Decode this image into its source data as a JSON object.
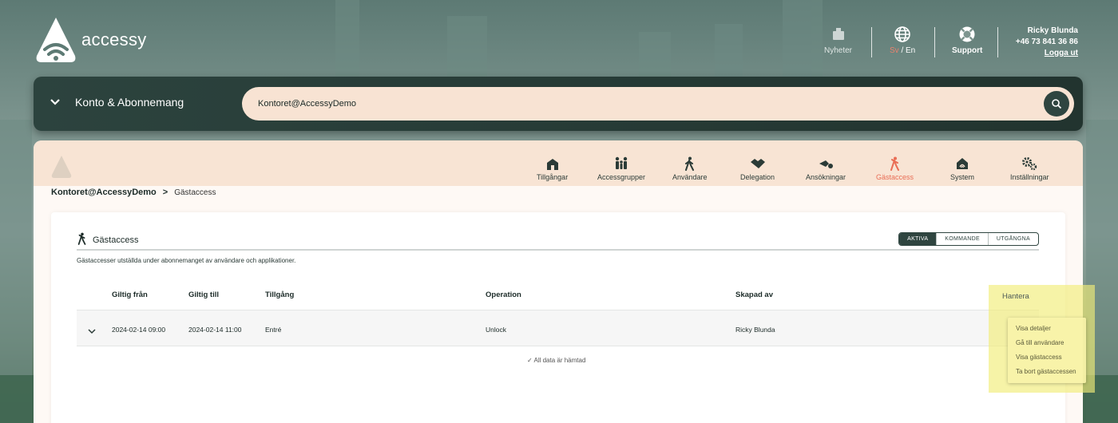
{
  "brand": {
    "name": "accessy"
  },
  "header": {
    "news_label": "Nyheter",
    "lang_sv": "Sv",
    "lang_sep": " / ",
    "lang_en": "En",
    "support_label": "Support",
    "user": {
      "name": "Ricky Blunda",
      "phone": "+46 73 841 36 86",
      "logout": "Logga ut"
    }
  },
  "account_bar": {
    "title": "Konto & Abonnemang",
    "search_value": "Kontoret@AccessyDemo"
  },
  "tabs": [
    {
      "label": "Tillgångar",
      "icon": "building-icon"
    },
    {
      "label": "Accessgrupper",
      "icon": "group-icon"
    },
    {
      "label": "Användare",
      "icon": "user-walking-icon"
    },
    {
      "label": "Delegation",
      "icon": "handshake-icon"
    },
    {
      "label": "Ansökningar",
      "icon": "application-icon"
    },
    {
      "label": "Gästaccess",
      "icon": "guest-icon",
      "active": true
    },
    {
      "label": "System",
      "icon": "system-icon"
    },
    {
      "label": "Inställningar",
      "icon": "gears-icon"
    }
  ],
  "breadcrumb": {
    "root": "Kontoret@AccessyDemo",
    "sep": ">",
    "current": "Gästaccess"
  },
  "card": {
    "title": "Gästaccess",
    "description": "Gästaccesser utställda under abonnemanget av användare och applikationer.",
    "filters": [
      "AKTIVA",
      "KOMMANDE",
      "UTGÅNGNA"
    ],
    "active_filter": "AKTIVA",
    "columns": [
      "Giltig från",
      "Giltig till",
      "Tillgång",
      "Operation",
      "Skapad av",
      "Hantera"
    ],
    "rows": [
      {
        "from": "2024-02-14 09:00",
        "to": "2024-02-14 11:00",
        "asset": "Entré",
        "operation": "Unlock",
        "created_by": "Ricky Blunda"
      }
    ],
    "status": "✓ All data är hämtad"
  },
  "row_menu": [
    "Visa detaljer",
    "Gå till användare",
    "Visa gästaccess",
    "Ta bort gästaccessen"
  ],
  "colors": {
    "accent": "#e96d55",
    "dark": "#2f4540",
    "peach": "#f8e4d4",
    "highlight": "#f1ec78"
  }
}
